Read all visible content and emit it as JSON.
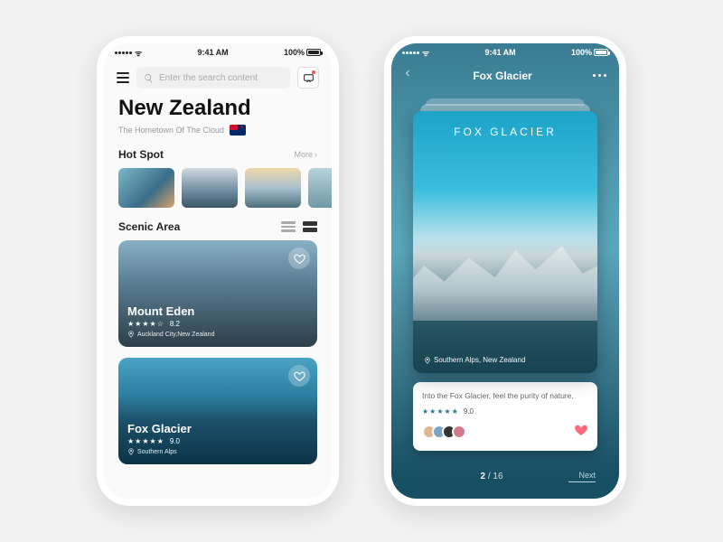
{
  "status": {
    "time": "9:41 AM",
    "battery": "100%"
  },
  "left": {
    "search": {
      "placeholder": "Enter the search content"
    },
    "title": "New Zealand",
    "subtitle": "The Hometown Of The Cloud",
    "hotspot": {
      "heading": "Hot Spot",
      "more": "More"
    },
    "scenic": {
      "heading": "Scenic Area"
    },
    "cards": [
      {
        "title": "Mount Eden",
        "rating": "8.2",
        "stars": "★★★★☆",
        "location": "Auckland City,New Zealand"
      },
      {
        "title": "Fox Glacier",
        "rating": "9.0",
        "stars": "★★★★★",
        "location": "Southern Alps"
      }
    ]
  },
  "right": {
    "title": "Fox Glacier",
    "hero": {
      "title": "FOX GLACIER",
      "location": "Southern Alps, New Zealand"
    },
    "desc": {
      "text": "Into the Fox Glacier, feel the purity of nature.",
      "stars": "★★★★★",
      "rating": "9.0"
    },
    "pager": {
      "current": "2",
      "sep": " / ",
      "total": "16",
      "next": "Next"
    }
  }
}
